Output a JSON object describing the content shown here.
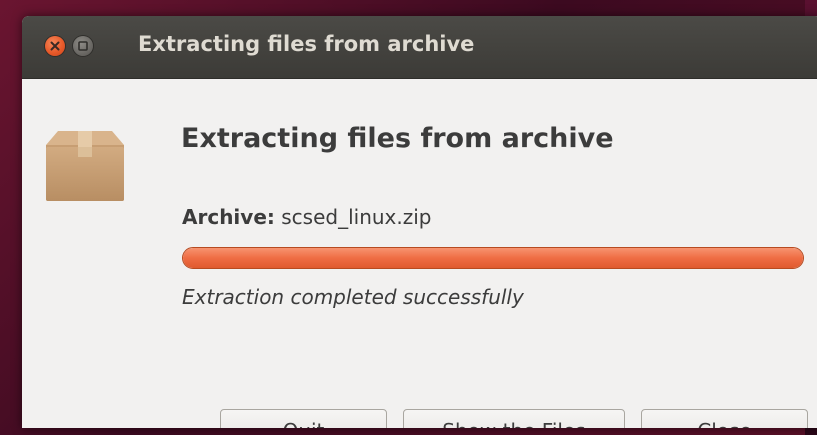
{
  "window": {
    "title": "Extracting files from archive"
  },
  "dialog": {
    "heading": "Extracting files from archive",
    "archive_label": "Archive:",
    "archive_name": "scsed_linux.zip",
    "progress": 1.0,
    "status": "Extraction completed successfully"
  },
  "buttons": {
    "quit": "Quit",
    "show_files": "Show the Files",
    "close": "Close"
  },
  "icons": {
    "window_close": "close-icon",
    "window_minimize": "minimize-icon",
    "archive": "package-icon"
  },
  "colors": {
    "accent": "#ef6d44",
    "titlebar": "#3c3b37",
    "close_button": "#e85a2a"
  }
}
